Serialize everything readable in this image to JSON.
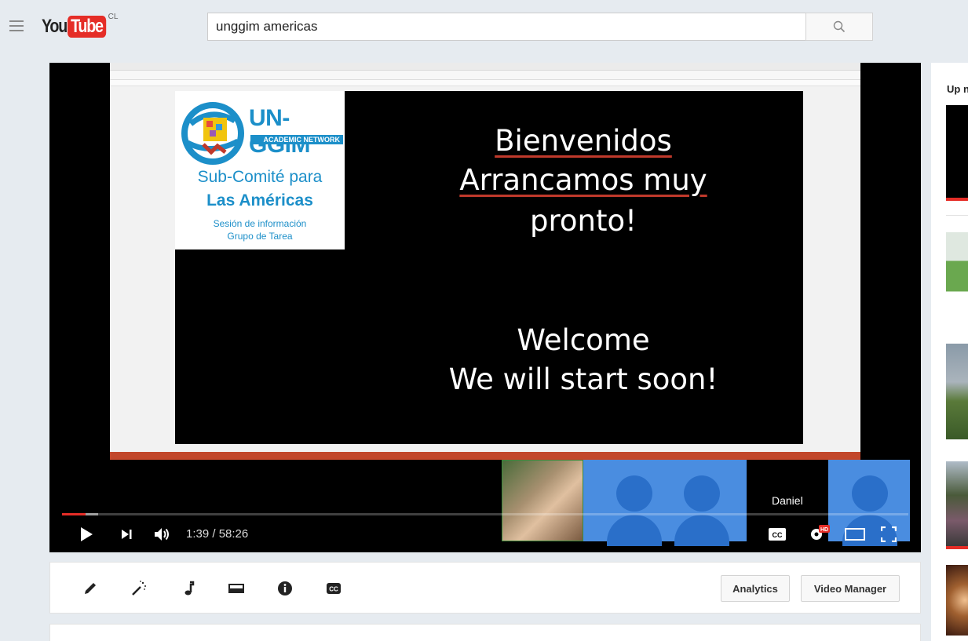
{
  "header": {
    "logo_you": "You",
    "logo_tube": "Tube",
    "country_code": "CL",
    "search_value": "unggim americas",
    "search_placeholder": "Search"
  },
  "player": {
    "slide": {
      "org_name": "UN-GGIM",
      "org_sub": "ACADEMIC NETWORK",
      "subcomite": "Sub-Comité para",
      "region": "Las Américas",
      "session": "Sesión de información",
      "group": "Grupo de Tarea",
      "line1": "Bienvenidos",
      "line2": "Arrancamos muy",
      "line3": "pronto!",
      "line4": "Welcome",
      "line5": "We will start soon!"
    },
    "participant_name": "Daniel",
    "time_display": "1:39 / 58:26",
    "progress_fraction": 0.028,
    "hd_badge": "HD"
  },
  "edit_toolbar": {
    "analytics_label": "Analytics",
    "video_manager_label": "Video Manager"
  },
  "sidebar": {
    "up_next_label": "Up n"
  },
  "colors": {
    "brand_red": "#e52d27",
    "un_blue": "#1c8fc9",
    "participant_blue": "#4a8de0"
  }
}
